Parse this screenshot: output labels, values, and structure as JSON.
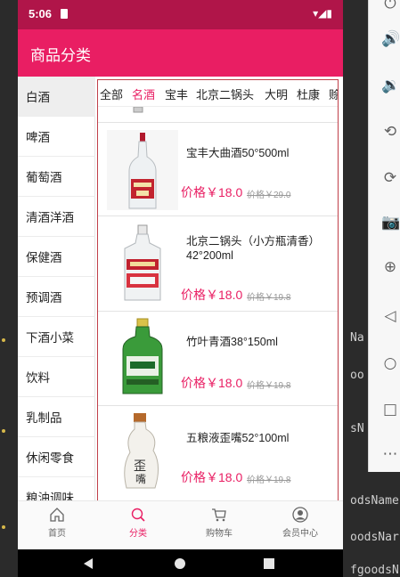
{
  "status_bar": {
    "time": "5:06",
    "icons": "▾◢▮"
  },
  "app_bar": {
    "title": "商品分类"
  },
  "sidebar": {
    "items": [
      {
        "label": "白酒",
        "active": true
      },
      {
        "label": "啤酒"
      },
      {
        "label": "葡萄酒"
      },
      {
        "label": "清酒洋酒"
      },
      {
        "label": "保健酒"
      },
      {
        "label": "预调酒"
      },
      {
        "label": "下酒小菜"
      },
      {
        "label": "饮料"
      },
      {
        "label": "乳制品"
      },
      {
        "label": "休闲零食"
      },
      {
        "label": "粮油调味"
      }
    ]
  },
  "brand_tabs": [
    {
      "label": "全部"
    },
    {
      "label": "名酒",
      "active": true
    },
    {
      "label": "宝丰"
    },
    {
      "label": "北京二锅头"
    },
    {
      "label": "大明"
    },
    {
      "label": "杜康"
    },
    {
      "label": "赊"
    }
  ],
  "products": [
    {
      "name": "宝丰大曲酒50°500ml",
      "price": "价格￥18.0",
      "original": "价格￥29.0",
      "bottle": "clear-red-label"
    },
    {
      "name": "北京二锅头（小方瓶清香）42°200ml",
      "price": "价格￥18.0",
      "original": "价格￥19.8",
      "bottle": "flat-red-label"
    },
    {
      "name": "竹叶青酒38°150ml",
      "price": "价格￥18.0",
      "original": "价格￥19.8",
      "bottle": "green"
    },
    {
      "name": "五粮液歪嘴52°100ml",
      "price": "价格￥18.0",
      "original": "价格￥19.8",
      "bottle": "white-ceramic"
    }
  ],
  "bottom_nav": {
    "items": [
      {
        "label": "首页",
        "icon": "home-icon"
      },
      {
        "label": "分类",
        "icon": "search-icon",
        "active": true
      },
      {
        "label": "购物车",
        "icon": "cart-icon"
      },
      {
        "label": "会员中心",
        "icon": "user-icon"
      }
    ]
  },
  "ide": {
    "code_lines": [
      "Na",
      "oo",
      "sN",
      "odsName",
      "oodsNar",
      "fgoodsN"
    ]
  },
  "colors": {
    "primary": "#e91e63",
    "status_bar": "#b01549"
  }
}
